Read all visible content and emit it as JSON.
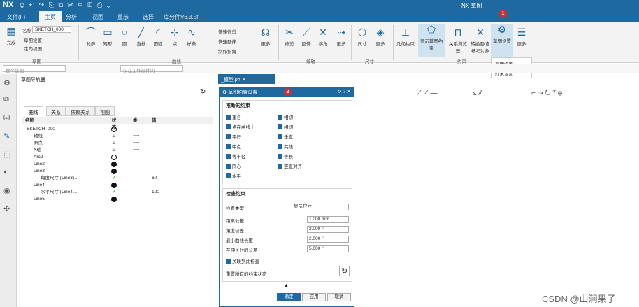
{
  "titlebar": {
    "logo": "NX",
    "quick_access": "⛭ ↶ ↷ ⎘ ⧉ ✂ ▭ ◫ ⎙ ⌄",
    "app": "NX 草图"
  },
  "menubar": {
    "items": [
      "文件(F)",
      "主页",
      "分析",
      "视图",
      "显示",
      "选择",
      "库分件V6.3.5f"
    ]
  },
  "ribbon": {
    "direct_sketch": {
      "finish": "完成",
      "sketch_label": "名称",
      "sketch_value": "SKETCH_000",
      "opt1": "草图设置",
      "opt2": "定向视图",
      "group": "草图"
    },
    "curve": {
      "items": [
        "轮廓",
        "矩形",
        "圆",
        "直线",
        "圆弧",
        "点",
        "样条"
      ],
      "group": "曲线"
    },
    "edit": {
      "items": [
        "快速修剪",
        "快速延伸",
        "制作拐角"
      ]
    },
    "constraint_group": {
      "items": [
        "修剪",
        "延伸",
        "拐角",
        "更多"
      ],
      "group": "编辑"
    },
    "dims": {
      "items": [
        "尺寸",
        "更多"
      ],
      "group": "尺寸"
    },
    "constraints": {
      "items": [
        "几何约束",
        "显示草图约束",
        "关系浏览器",
        "转换至/自参考对象",
        "草图设置",
        "更多"
      ],
      "group": "约束"
    },
    "dropdown": {
      "items": [
        "草图设置",
        "约束设置"
      ]
    }
  },
  "toolbar2": {
    "filter": "整个装配",
    "select_scope": "仅在工作部件内"
  },
  "navigator": {
    "title": "草图导航器",
    "tabs": [
      "曲线",
      "关系",
      "依赖关系",
      "视图"
    ],
    "columns": [
      "名称",
      "状态",
      "类",
      "值"
    ],
    "rows": [
      {
        "name": "SKETCH_000",
        "indent": 0,
        "status": "ring",
        "cls": "",
        "val": ""
      },
      {
        "name": "轴线",
        "indent": 1,
        "status": "down",
        "cls": "⟺",
        "val": ""
      },
      {
        "name": "原点",
        "indent": 1,
        "status": "down",
        "cls": "⟺",
        "val": ""
      },
      {
        "name": "X轴",
        "indent": 1,
        "status": "down",
        "cls": "⟺",
        "val": ""
      },
      {
        "name": "Arc2",
        "indent": 1,
        "status": "ring",
        "cls": "",
        "val": ""
      },
      {
        "name": "Line2",
        "indent": 1,
        "status": "dot",
        "cls": "",
        "val": ""
      },
      {
        "name": "Line3",
        "indent": 1,
        "status": "dot",
        "cls": "",
        "val": ""
      },
      {
        "name": "角度尺寸 (Line3)…",
        "indent": 2,
        "status": "check",
        "cls": "",
        "val": "60"
      },
      {
        "name": "Line4",
        "indent": 1,
        "status": "dot",
        "cls": "",
        "val": ""
      },
      {
        "name": "水平尺寸 (Line4…",
        "indent": 2,
        "status": "check",
        "cls": "",
        "val": "120"
      },
      {
        "name": "Line5",
        "indent": 1,
        "status": "dot",
        "cls": "",
        "val": ""
      }
    ]
  },
  "graphics_tab": "_模型.prt ✕",
  "dialog": {
    "title": "草图约束设置",
    "section1": "推断的约束",
    "constraints_left": [
      "重合",
      "点在曲线上",
      "平行",
      "中点",
      "等半径",
      "同心",
      "水平"
    ],
    "constraints_right": [
      "相切",
      "相切",
      "垂直",
      "共线",
      "等长",
      "竖直对齐"
    ],
    "section2": "检查约束",
    "check_label": "检查类型",
    "check_value": "显示尺寸",
    "fields": [
      {
        "label": "距离公差",
        "value": "1.000 mm"
      },
      {
        "label": "角度公差",
        "value": "2.000 °"
      },
      {
        "label": "最小曲线长度",
        "value": "2.000 °"
      },
      {
        "label": "在伸长时的公差",
        "value": "5.000 °"
      }
    ],
    "auto_check": "关联到此检查",
    "reset_label": "重置所有的约束状态",
    "buttons": {
      "ok": "确定",
      "apply": "应用",
      "cancel": "取消"
    }
  },
  "badges": {
    "b1": "1",
    "b2": "2"
  },
  "watermark": "CSDN @山涧果子",
  "colors": {
    "brand": "#1e6aa0",
    "badge": "#e2262b",
    "ok": "#2ba12b"
  }
}
